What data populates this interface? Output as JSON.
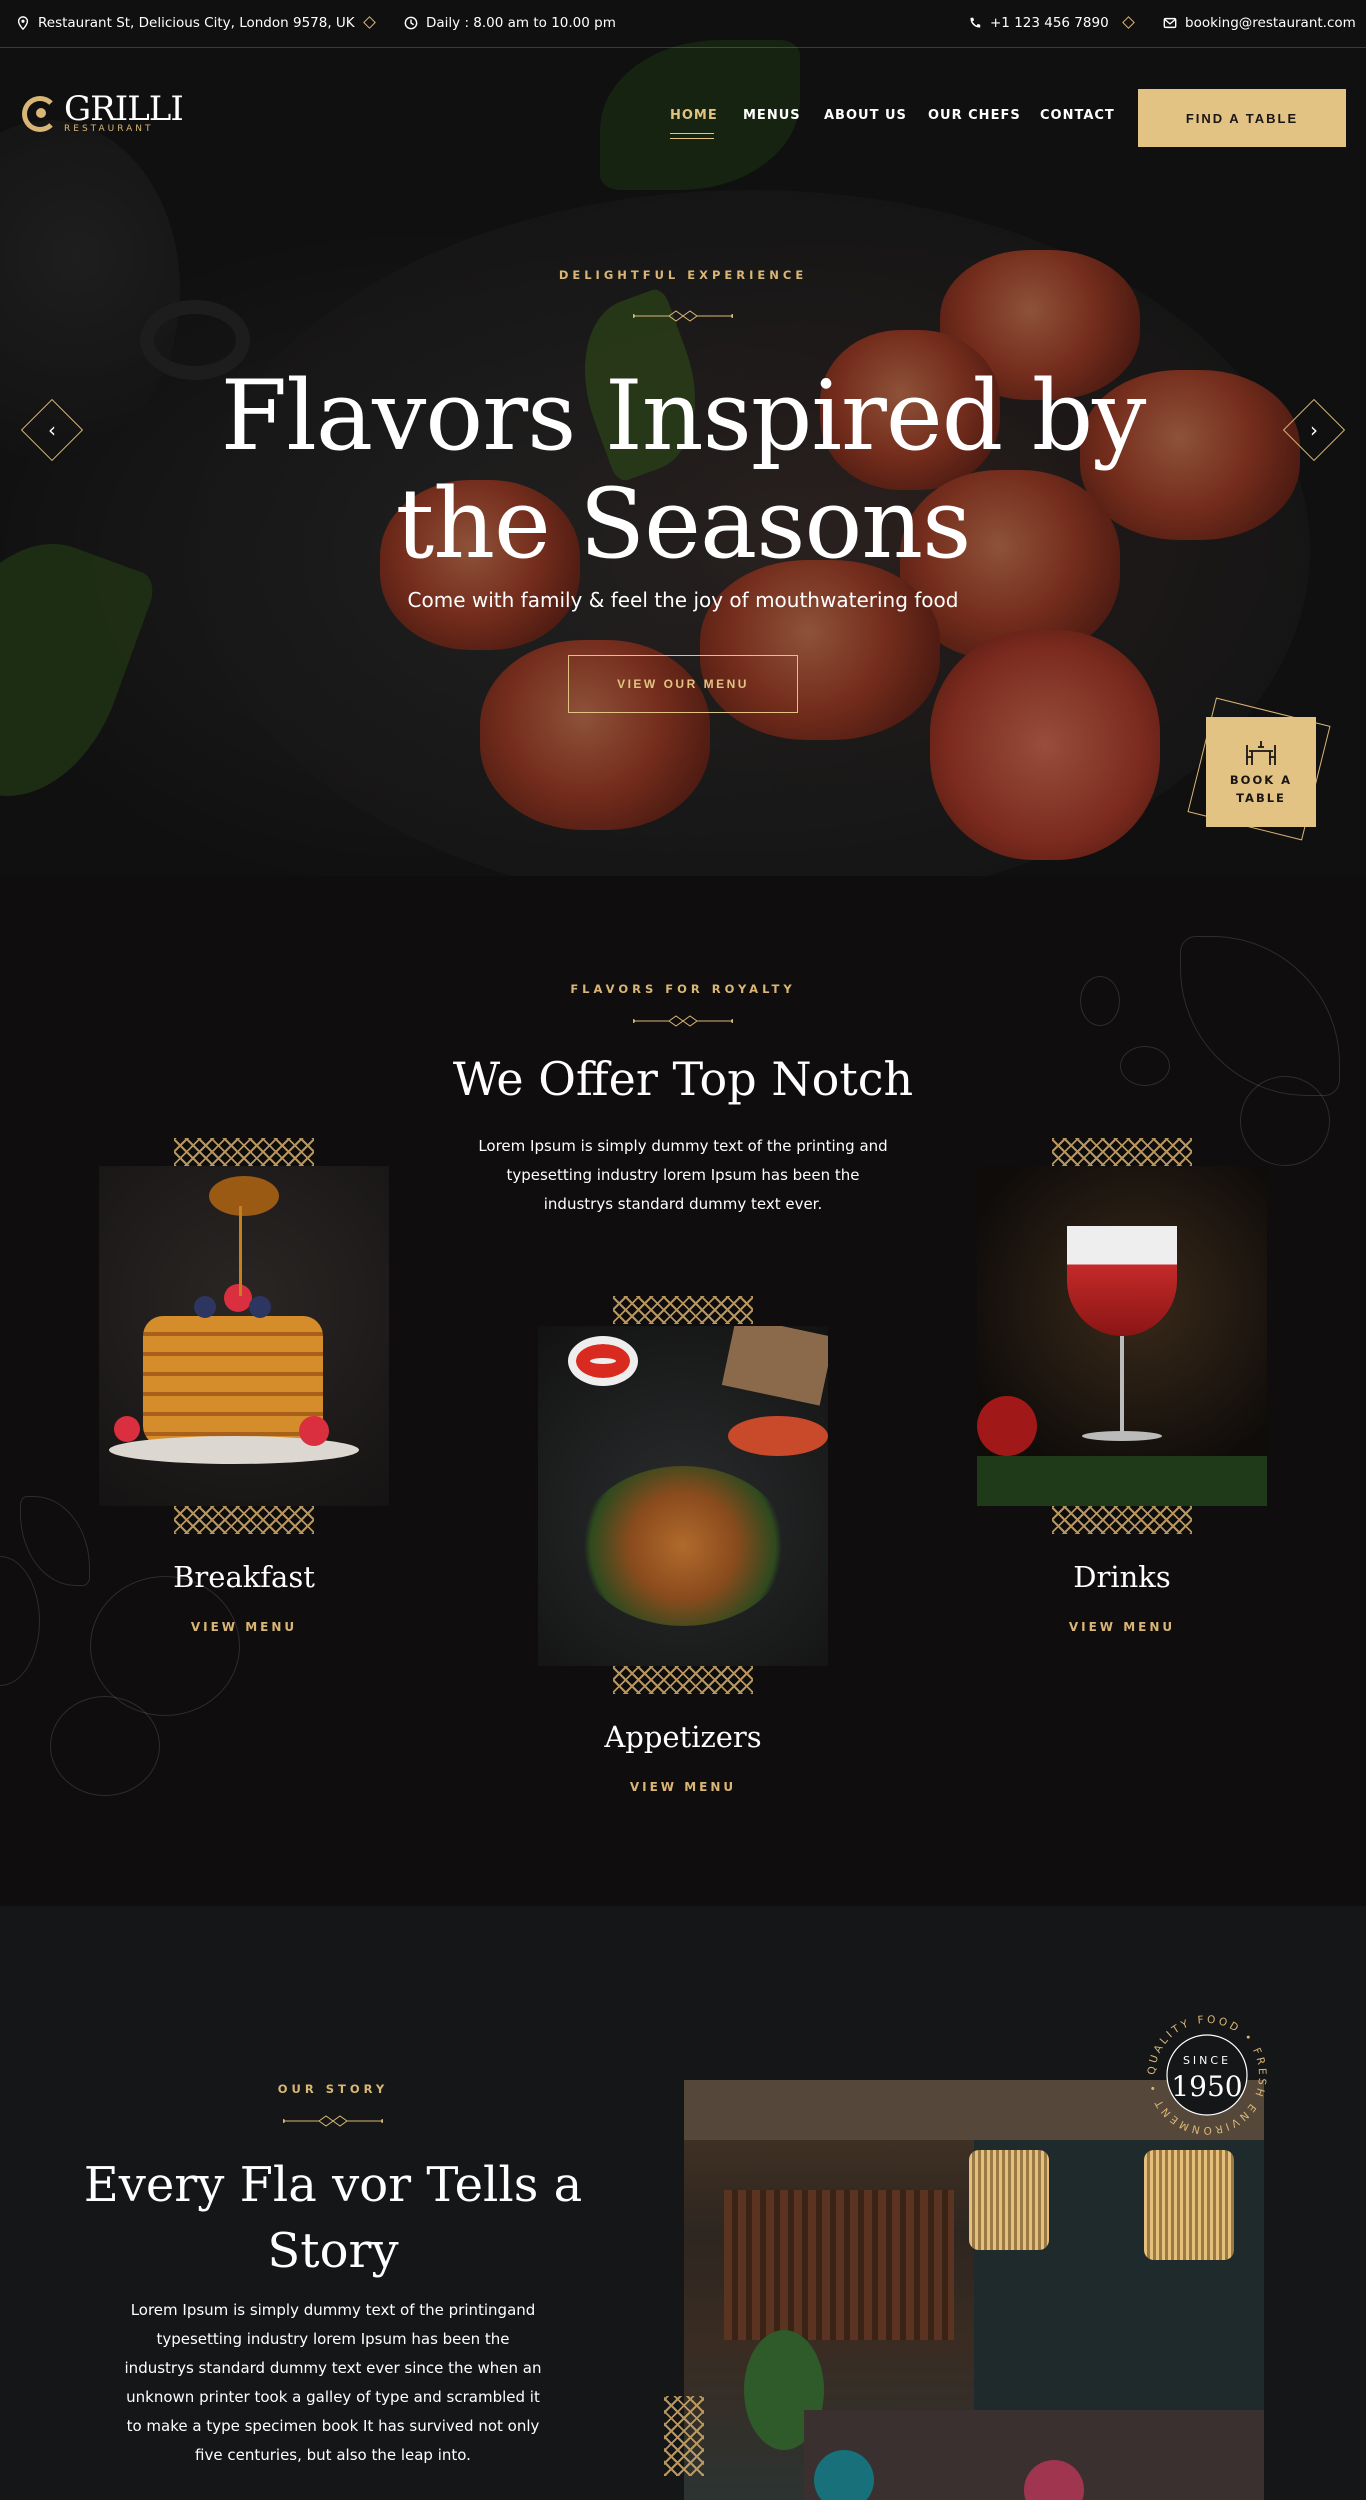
{
  "topbar": {
    "address": "Restaurant St, Delicious City, London 9578, UK",
    "hours": "Daily : 8.00 am to 10.00 pm",
    "phone": "+1 123 456 7890",
    "email": "booking@restaurant.com"
  },
  "logo": {
    "name": "GRILLI",
    "sub": "RESTAURANT"
  },
  "nav": {
    "items": [
      "HOME",
      "MENUS",
      "ABOUT US",
      "OUR CHEFS",
      "CONTACT"
    ],
    "active": "HOME",
    "cta": "FIND A TABLE"
  },
  "hero": {
    "eyebrow": "DELIGHTFUL EXPERIENCE",
    "title_line1": "Flavors Inspired by",
    "title_line2": "the Seasons",
    "subtitle": "Come with family & feel the joy of mouthwatering food",
    "button": "VIEW OUR MENU",
    "book_line1": "BOOK A",
    "book_line2": "TABLE",
    "prev_icon": "chevron-left-icon",
    "next_icon": "chevron-right-icon"
  },
  "offer": {
    "eyebrow": "FLAVORS FOR ROYALTY",
    "title": "We Offer Top Notch",
    "text": "Lorem Ipsum is simply dummy text of the printing and typesetting industry lorem Ipsum has been the industrys standard dummy text ever.",
    "cards": [
      {
        "title": "Breakfast",
        "link": "VIEW MENU"
      },
      {
        "title": "Appetizers",
        "link": "VIEW MENU"
      },
      {
        "title": "Drinks",
        "link": "VIEW MENU"
      }
    ]
  },
  "story": {
    "eyebrow": "OUR STORY",
    "title_line1": "Every Fla vor Tells a",
    "title_line2": "Story",
    "text": "Lorem Ipsum is simply dummy text of the printingand typesetting industry lorem Ipsum has been the industrys standard dummy text ever since the when an unknown printer took a galley of type and scrambled it to make a type specimen book It has survived not only five centuries, but also the leap into.",
    "badge_ring": "QUALITY FOOD • FRESH ENVIRONMENT •",
    "badge_since": "SINCE",
    "badge_year": "1950"
  },
  "colors": {
    "accent": "#e2c384",
    "gold": "#d9b676",
    "bg_dark": "#0f0d0d"
  }
}
